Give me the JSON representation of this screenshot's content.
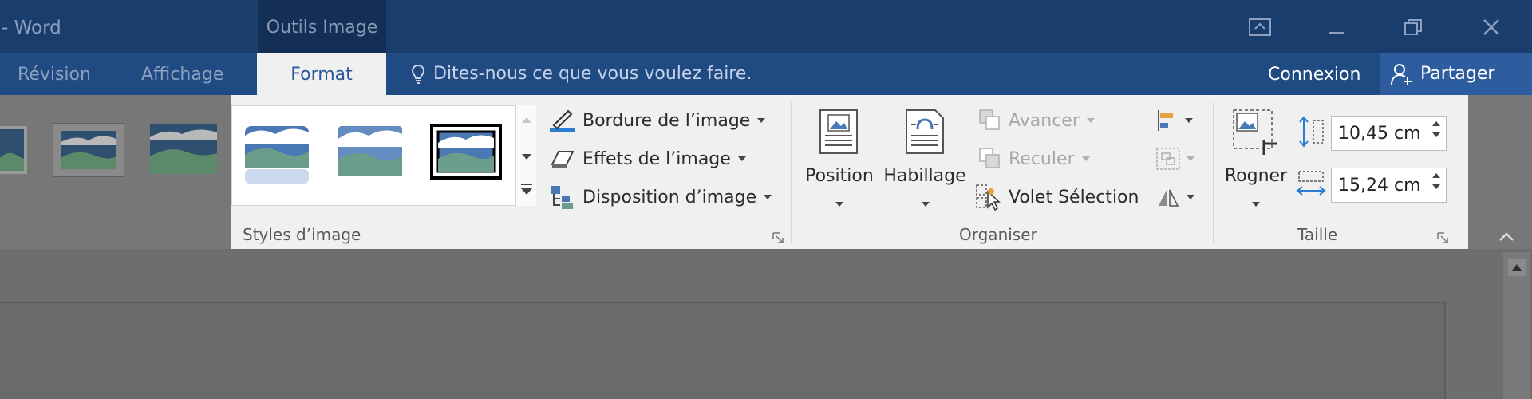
{
  "window": {
    "title": "- Word",
    "contextual_label": "Outils Image"
  },
  "tabs": {
    "revision": "Révision",
    "affichage": "Affichage",
    "format": "Format"
  },
  "tell_me": "Dites-nous ce que vous voulez faire.",
  "account": {
    "connexion": "Connexion",
    "share": "Partager"
  },
  "ribbon": {
    "styles_group": {
      "label": "Styles d’image",
      "commands": {
        "border": "Bordure de l’image",
        "effects": "Effets de l’image",
        "layout": "Disposition d’image"
      }
    },
    "arrange_group": {
      "label": "Organiser",
      "position": "Position",
      "wrap": "Habillage",
      "bring_forward": "Avancer",
      "send_backward": "Reculer",
      "selection_pane": "Volet Sélection"
    },
    "size_group": {
      "label": "Taille",
      "crop": "Rogner",
      "height": "10,45 cm",
      "width": "15,24 cm"
    }
  },
  "colors": {
    "title_bar": "#193e6e",
    "tabs_bar": "#1f4a82",
    "accent": "#2b579a",
    "ribbon": "#f0f0f0"
  }
}
